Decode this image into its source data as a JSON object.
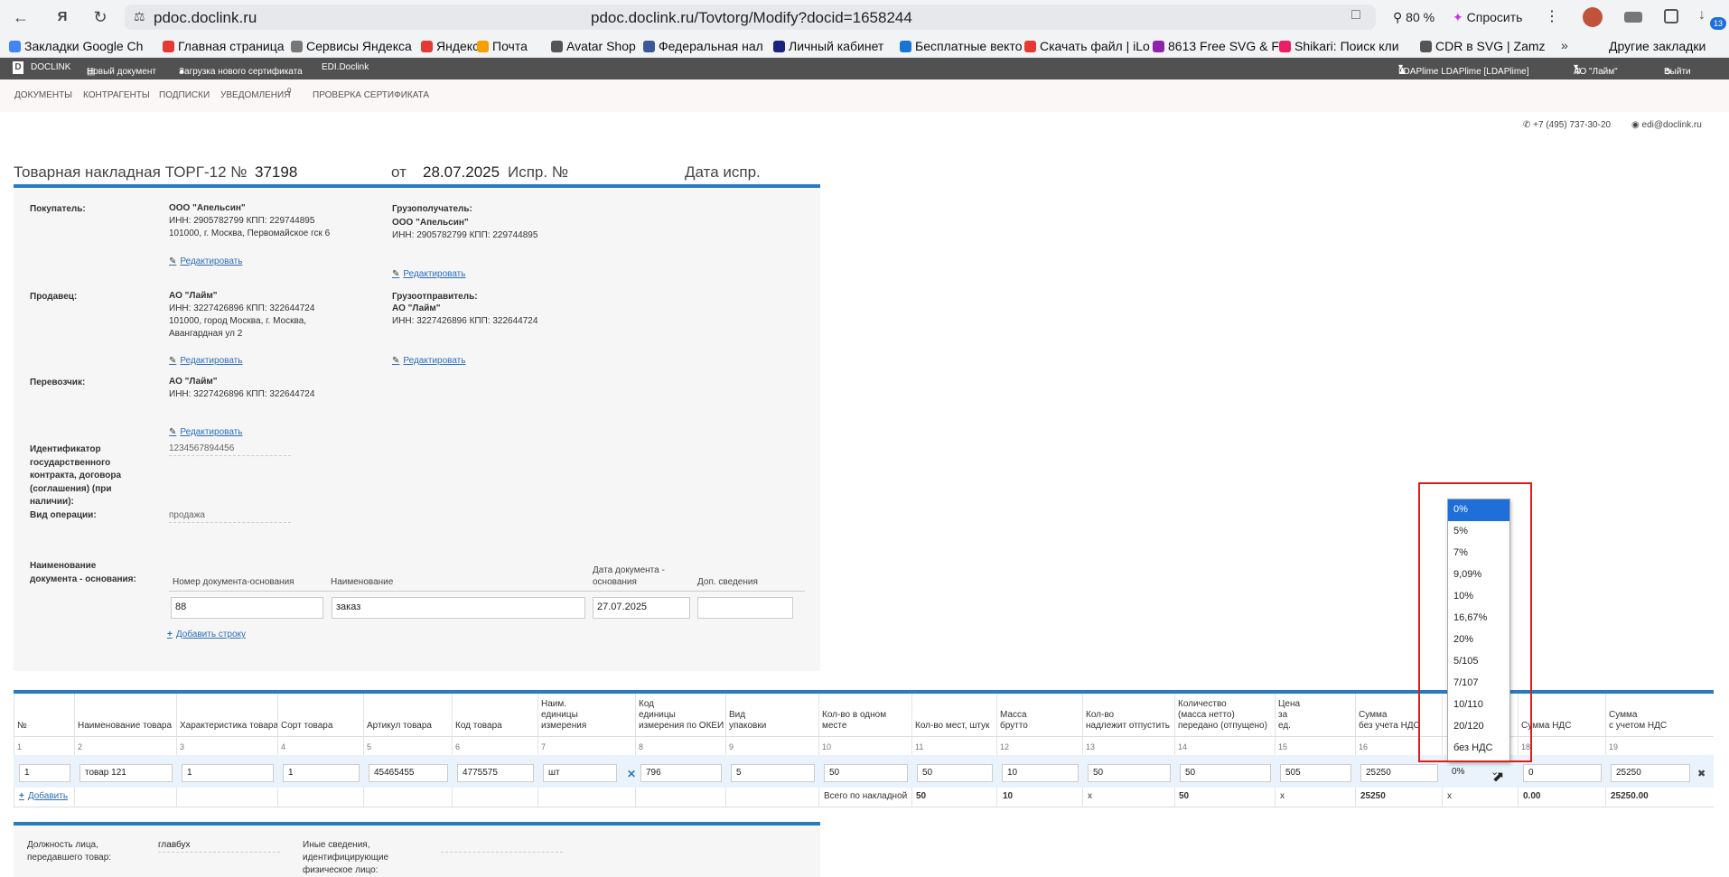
{
  "browser": {
    "host": "pdoc.doclink.ru",
    "url": "pdoc.doclink.ru/Tovtorg/Modify?docid=1658244",
    "zoom": "80 %",
    "ask": "Спросить",
    "badge": "13",
    "bookmarks": [
      {
        "label": "Закладки Google Ch",
        "color": "#4285f4"
      },
      {
        "label": "Главная страница",
        "color": "#e53935"
      },
      {
        "label": "Сервисы Яндекса",
        "color": "#777777"
      },
      {
        "label": "Яндекс",
        "color": "#e53935"
      },
      {
        "label": "Почта",
        "color": "#f6a000"
      },
      {
        "label": "Avatar Shop",
        "color": "#555555"
      },
      {
        "label": "Федеральная нал",
        "color": "#3b5998"
      },
      {
        "label": "Личный кабинет",
        "color": "#1a237e"
      },
      {
        "label": "Бесплатные векто",
        "color": "#1976d2"
      },
      {
        "label": "Скачать файл | iLo",
        "color": "#e53935"
      },
      {
        "label": "8613 Free SVG & F",
        "color": "#8e24aa"
      },
      {
        "label": "Shikari: Поиск кли",
        "color": "#e91e63"
      },
      {
        "label": "CDR в SVG | Zamz",
        "color": "#555555"
      },
      {
        "label": "Другие закладки",
        "color": "#f2f3f5"
      }
    ]
  },
  "app": {
    "logo": "DOCLINK",
    "new_doc": "Новый документ",
    "upload_cert": "Загрузка нового сертификата",
    "edi": "EDI.Doclink",
    "user": "LDAPlime LDAPlime [LDAPlime]",
    "org": "АО \"Лайм\"",
    "logout": "Выйти",
    "menu": [
      "ДОКУМЕНТЫ",
      "КОНТРАГЕНТЫ",
      "ПОДПИСКИ",
      "УВЕДОМЛЕНИЯ",
      "ПРОВЕРКА СЕРТИФИКАТА"
    ],
    "notif_count": "0",
    "phone": "+7 (495) 737-30-20",
    "email": "edi@doclink.ru"
  },
  "doc": {
    "title": "Товарная накладная ТОРГ-12 №",
    "number": "37198",
    "from_label": "от",
    "date": "28.07.2025",
    "fix_label": "Испр. №",
    "fix_date_label": "Дата испр.",
    "edit_label": "Редактировать",
    "buyer_label": "Покупатель:",
    "buyer_name": "ООО \"Апельсин\"",
    "buyer_inn": "ИНН: 2905782799 КПП: 229744895",
    "buyer_addr": "101000, г. Москва, Первомайское гск 6",
    "consignee_label": "Грузополучатель:",
    "consignee_name": "ООО \"Апельсин\"",
    "consignee_inn": "ИНН: 2905782799 КПП: 229744895",
    "seller_label": "Продавец:",
    "seller_name": "АО \"Лайм\"",
    "seller_inn": "ИНН: 3227426896 КПП: 322644724",
    "seller_addr1": "101000, город Москва, г. Москва,",
    "seller_addr2": "Авангардная ул 2",
    "shipper_label": "Грузоотправитель:",
    "shipper_name": "АО \"Лайм\"",
    "shipper_inn": "ИНН: 3227426896 КПП: 322644724",
    "carrier_label": "Перевозчик:",
    "carrier_name": "АО \"Лайм\"",
    "carrier_inn": "ИНН: 3227426896 КПП: 322644724",
    "contract_label": [
      "Идентификатор",
      "государственного",
      "контракта, договора",
      "(соглашения) (при",
      "наличии):"
    ],
    "contract_value": "1234567894456",
    "operation_label": "Вид операции:",
    "operation_value": "продажа",
    "basis_label": [
      "Наименование",
      "документа - основания:"
    ],
    "basis_headers": {
      "num": "Номер документа-основания",
      "name": "Наименование",
      "date1": "Дата документа -",
      "date2": "основания",
      "extra": "Доп. сведения"
    },
    "basis_row": {
      "num": "88",
      "name": "заказ",
      "date": "27.07.2025",
      "extra": ""
    },
    "add_row": "Добавить строку"
  },
  "table": {
    "headers": [
      [
        "№"
      ],
      [
        "Наименование товара"
      ],
      [
        "Характеристика товара"
      ],
      [
        "Сорт товара"
      ],
      [
        "Артикул товара"
      ],
      [
        "Код товара"
      ],
      [
        "Наим.",
        "единицы",
        "измерения"
      ],
      [
        "Код",
        "единицы",
        "измерения по ОКЕИ"
      ],
      [
        "Вид",
        "упаковки"
      ],
      [
        "Кол-во в одном",
        "месте"
      ],
      [
        "Кол-во мест, штук"
      ],
      [
        "Масса",
        "брутто"
      ],
      [
        "Кол-во",
        "надлежит отпустить"
      ],
      [
        "Количество",
        "(масса нетто)",
        "передано (отпущено)"
      ],
      [
        "Цена",
        "за",
        "ед."
      ],
      [
        "Сумма",
        "без учета НДС"
      ],
      [
        ""
      ],
      [
        "Сумма НДС"
      ],
      [
        "Сумма",
        "с учетом НДС"
      ]
    ],
    "colnums": [
      "1",
      "2",
      "3",
      "4",
      "5",
      "6",
      "7",
      "8",
      "9",
      "10",
      "11",
      "12",
      "13",
      "14",
      "15",
      "16",
      "",
      "18",
      "19"
    ],
    "row": [
      "1",
      "товар 121",
      "1",
      "1",
      "45465455",
      "4775575",
      "шт",
      "796",
      "5",
      "50",
      "50",
      "10",
      "50",
      "50",
      "505",
      "25250",
      "0%",
      "0",
      "25250"
    ],
    "add": "Добавить",
    "totals_label": "Всего по накладной",
    "totals": {
      "places": "50",
      "mass": "10",
      "x1": "х",
      "qty": "50",
      "x2": "х",
      "sum": "25250",
      "x3": "х",
      "vat": "0.00",
      "total": "25250.00"
    }
  },
  "vat_dropdown": {
    "options": [
      "0%",
      "5%",
      "7%",
      "9,09%",
      "10%",
      "16,67%",
      "20%",
      "5/105",
      "7/107",
      "10/110",
      "20/120",
      "без НДС"
    ],
    "selected": "0%"
  },
  "footer": {
    "pos_label1": "Должность лица,",
    "pos_label2": "передавшего товар:",
    "pos_value": "главбух",
    "other_label1": "Иные сведения,",
    "other_label2": "идентифицирующие",
    "other_label3": "физическое лицо:"
  }
}
